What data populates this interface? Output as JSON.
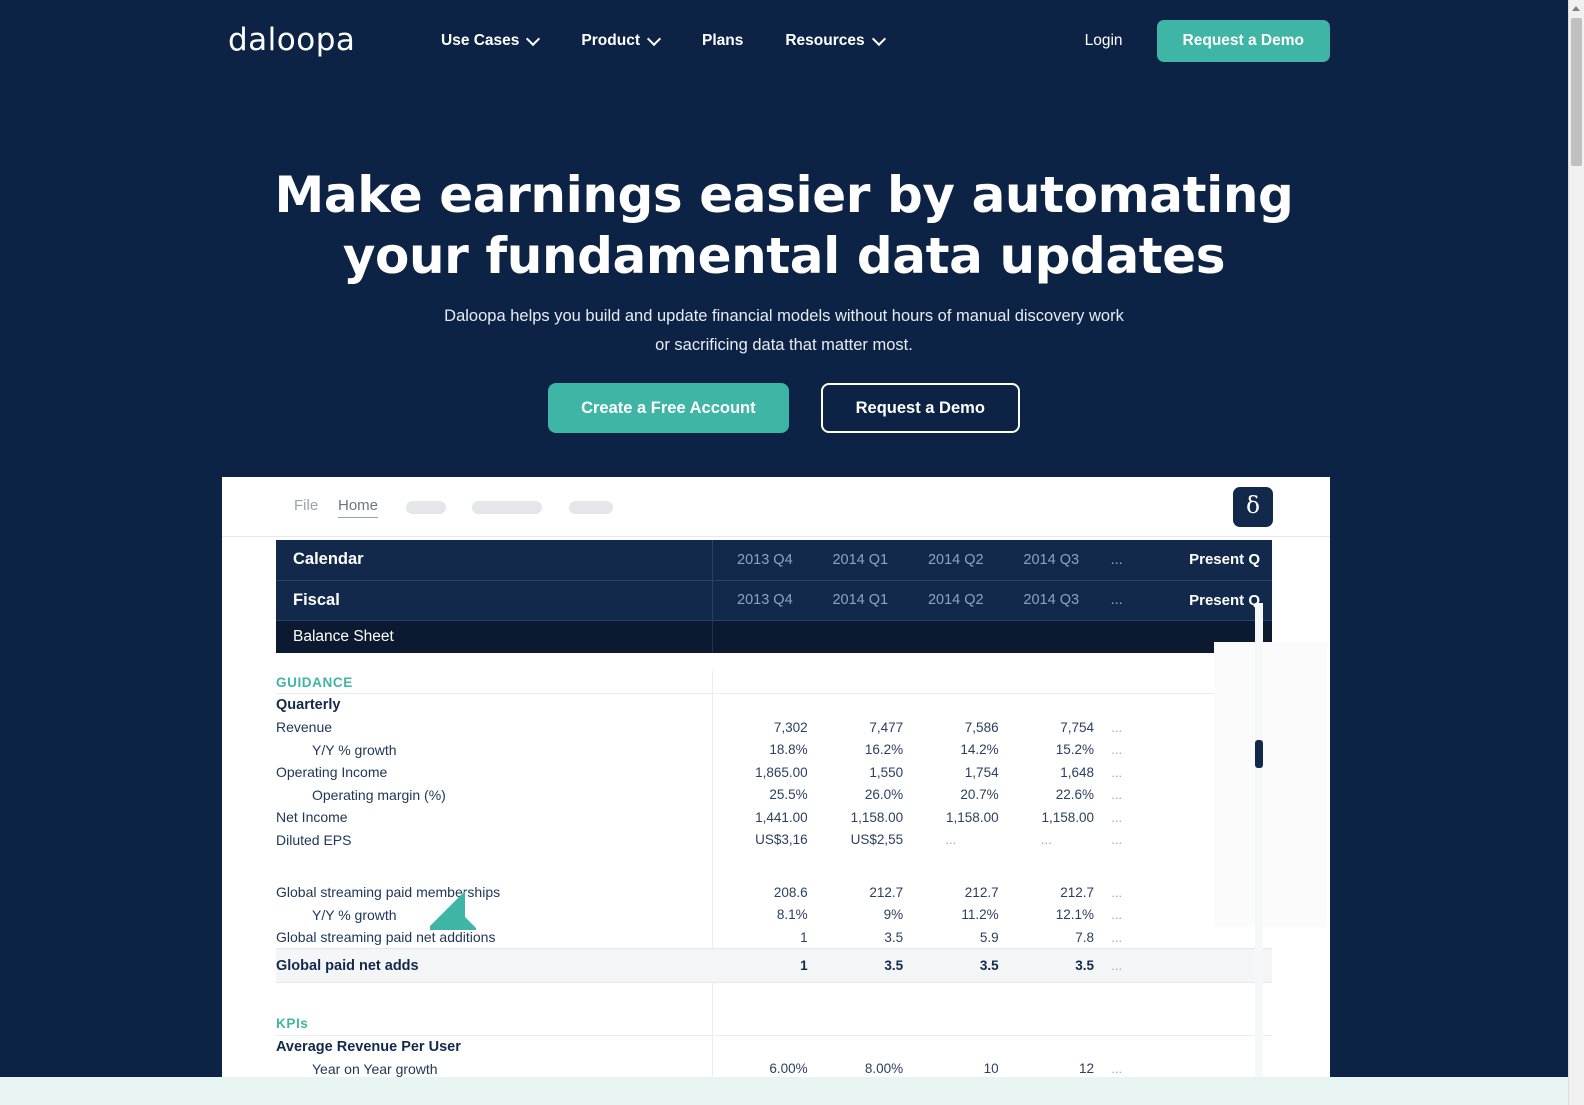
{
  "nav": {
    "logo": "daloopa",
    "items": [
      {
        "label": "Use Cases",
        "has_chevron": true,
        "icon": "chevron-down-icon"
      },
      {
        "label": "Product",
        "has_chevron": true,
        "icon": "chevron-down-icon"
      },
      {
        "label": "Plans",
        "has_chevron": false
      },
      {
        "label": "Resources",
        "has_chevron": true,
        "icon": "chevron-down-icon"
      }
    ],
    "login_label": "Login",
    "demo_label": "Request a Demo"
  },
  "hero": {
    "title_line1": "Make earnings easier by automating",
    "title_line2": "your fundamental data updates",
    "sub_line1": "Daloopa helps you build and update financial models without hours of manual discovery work",
    "sub_line2": "or sacrificing data that matter most.",
    "cta_primary": "Create a Free Account",
    "cta_secondary": "Request a Demo"
  },
  "app": {
    "toolbar": {
      "file_label": "File",
      "home_label": "Home",
      "brand_glyph": "δ"
    },
    "header_rows": [
      {
        "label": "Calendar",
        "cols": [
          "2013 Q4",
          "2014 Q1",
          "2014 Q2",
          "2014 Q3"
        ],
        "dots": "...",
        "present": "Present Q"
      },
      {
        "label": "Fiscal",
        "cols": [
          "2013 Q4",
          "2014 Q1",
          "2014 Q2",
          "2014 Q3"
        ],
        "dots": "...",
        "present": "Present Q"
      }
    ],
    "statement_label": "Balance Sheet",
    "sections": [
      {
        "title": "GUIDANCE"
      },
      {
        "title": "KPIs"
      }
    ],
    "guidance": {
      "title": "GUIDANCE",
      "subhead": "Quarterly",
      "rows": [
        {
          "label": "Revenue",
          "indent": false,
          "bold": false,
          "values": [
            "7,302",
            "7,477",
            "7,586",
            "7,754"
          ],
          "dots": "..."
        },
        {
          "label": "Y/Y % growth",
          "indent": true,
          "bold": false,
          "values": [
            "18.8%",
            "16.2%",
            "14.2%",
            "15.2%"
          ],
          "dots": "..."
        },
        {
          "label": "Operating Income",
          "indent": false,
          "bold": false,
          "values": [
            "1,865.00",
            "1,550",
            "1,754",
            "1,648"
          ],
          "dots": "..."
        },
        {
          "label": "Operating margin (%)",
          "indent": true,
          "bold": false,
          "values": [
            "25.5%",
            "26.0%",
            "20.7%",
            "22.6%"
          ],
          "dots": "..."
        },
        {
          "label": "Net Income",
          "indent": false,
          "bold": false,
          "values": [
            "1,441.00",
            "1,158.00",
            "1,158.00",
            "1,158.00"
          ],
          "dots": "..."
        },
        {
          "label": "Diluted EPS",
          "indent": false,
          "bold": false,
          "values": [
            "US$3,16",
            "US$2,55",
            "...",
            "..."
          ],
          "dots": "..."
        }
      ],
      "streaming_rows": [
        {
          "label": "Global streaming paid memberships",
          "indent": false,
          "bold": false,
          "values": [
            "208.6",
            "212.7",
            "212.7",
            "212.7"
          ],
          "dots": "..."
        },
        {
          "label": "Y/Y % growth",
          "indent": true,
          "bold": false,
          "values": [
            "8.1%",
            "9%",
            "11.2%",
            "12.1%"
          ],
          "dots": "..."
        },
        {
          "label": "Global streaming paid net additions",
          "indent": false,
          "bold": false,
          "values": [
            "1",
            "3.5",
            "5.9",
            "7.8"
          ],
          "dots": "..."
        }
      ],
      "total_row": {
        "label": "Global paid net adds",
        "values": [
          "1",
          "3.5",
          "3.5",
          "3.5"
        ],
        "dots": "..."
      }
    },
    "kpis": {
      "title": "KPIs",
      "subhead": "Average Revenue Per User",
      "rows": [
        {
          "label": "Year on Year growth",
          "indent": true,
          "bold": false,
          "values": [
            "6.00%",
            "8.00%",
            "10",
            "12"
          ],
          "dots": "..."
        }
      ]
    }
  },
  "colors": {
    "navy": "#0d2345",
    "deep_navy": "#13294b",
    "teal": "#3fb5a5",
    "mint_band": "#e8f4f2"
  }
}
